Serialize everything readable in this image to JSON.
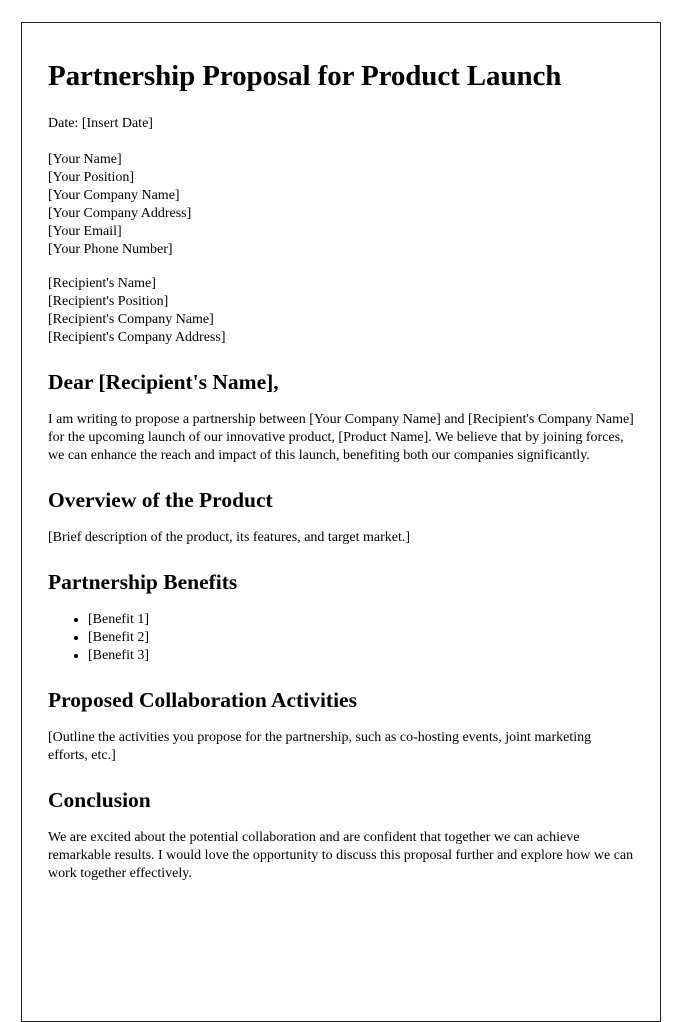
{
  "document": {
    "title": "Partnership Proposal for Product Launch",
    "date_line": "Date: [Insert Date]",
    "sender_block": [
      "[Your Name]",
      "[Your Position]",
      "[Your Company Name]",
      "[Your Company Address]",
      "[Your Email]",
      "[Your Phone Number]"
    ],
    "recipient_block": [
      "[Recipient's Name]",
      "[Recipient's Position]",
      "[Recipient's Company Name]",
      "[Recipient's Company Address]"
    ],
    "salutation": "Dear [Recipient's Name],",
    "intro_paragraph": "I am writing to propose a partnership between [Your Company Name] and [Recipient's Company Name] for the upcoming launch of our innovative product, [Product Name]. We believe that by joining forces, we can enhance the reach and impact of this launch, benefiting both our companies significantly.",
    "sections": [
      {
        "heading": "Overview of the Product",
        "paragraph": "[Brief description of the product, its features, and target market.]"
      },
      {
        "heading": "Partnership Benefits",
        "bullets": [
          "[Benefit 1]",
          "[Benefit 2]",
          "[Benefit 3]"
        ]
      },
      {
        "heading": "Proposed Collaboration Activities",
        "paragraph": "[Outline the activities you propose for the partnership, such as co-hosting events, joint marketing efforts, etc.]"
      },
      {
        "heading": "Conclusion",
        "paragraph": "We are excited about the potential collaboration and are confident that together we can achieve remarkable results. I would love the opportunity to discuss this proposal further and explore how we can work together effectively."
      }
    ]
  }
}
